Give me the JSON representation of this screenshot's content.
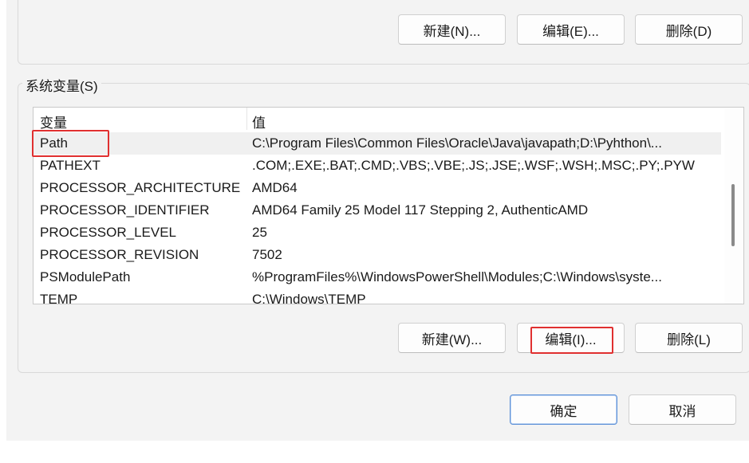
{
  "user_vars": {
    "buttons": {
      "new": "新建(N)...",
      "edit": "编辑(E)...",
      "delete": "删除(D)"
    }
  },
  "system_vars": {
    "group_label": "系统变量(S)",
    "columns": {
      "variable": "变量",
      "value": "值"
    },
    "rows": [
      {
        "name": "Path",
        "value": "C:\\Program Files\\Common Files\\Oracle\\Java\\javapath;D:\\Pyhthon\\..."
      },
      {
        "name": "PATHEXT",
        "value": ".COM;.EXE;.BAT;.CMD;.VBS;.VBE;.JS;.JSE;.WSF;.WSH;.MSC;.PY;.PYW"
      },
      {
        "name": "PROCESSOR_ARCHITECTURE",
        "value": "AMD64"
      },
      {
        "name": "PROCESSOR_IDENTIFIER",
        "value": "AMD64 Family 25 Model 117 Stepping 2, AuthenticAMD"
      },
      {
        "name": "PROCESSOR_LEVEL",
        "value": "25"
      },
      {
        "name": "PROCESSOR_REVISION",
        "value": "7502"
      },
      {
        "name": "PSModulePath",
        "value": "%ProgramFiles%\\WindowsPowerShell\\Modules;C:\\Windows\\syste..."
      },
      {
        "name": "TEMP",
        "value": "C:\\Windows\\TEMP"
      }
    ],
    "buttons": {
      "new": "新建(W)...",
      "edit": "编辑(I)...",
      "delete": "删除(L)"
    }
  },
  "dialog_buttons": {
    "ok": "确定",
    "cancel": "取消"
  },
  "colors": {
    "highlight": "#e03030",
    "primary_border": "#5b8fd6"
  }
}
